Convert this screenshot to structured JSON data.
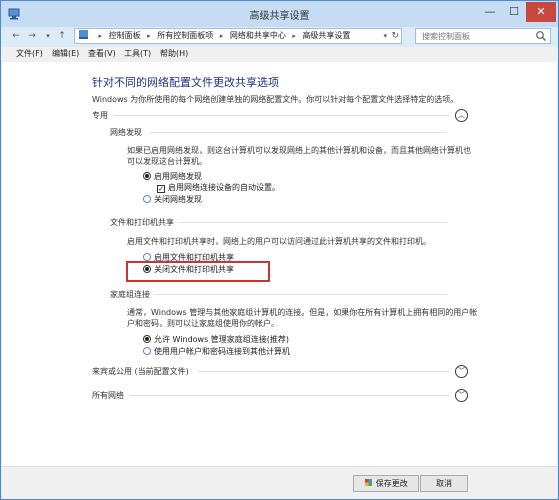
{
  "window": {
    "title": "高级共享设置",
    "min_glyph": "—",
    "max_glyph": "☐",
    "close_glyph": "✕"
  },
  "nav": {
    "back": "←",
    "forward": "→",
    "up": "↑",
    "breadcrumbs": [
      "控制面板",
      "所有控制面板项",
      "网络和共享中心",
      "高级共享设置"
    ],
    "search_placeholder": "搜索控制面板"
  },
  "menu": [
    "文件(F)",
    "编辑(E)",
    "查看(V)",
    "工具(T)",
    "帮助(H)"
  ],
  "main": {
    "heading": "针对不同的网络配置文件更改共享选项",
    "subtext": "Windows 为你所使用的每个网络创建单独的网络配置文件。你可以针对每个配置文件选择特定的选项。",
    "profile_private": {
      "label": "专用",
      "expander": "︿",
      "network_discovery": {
        "title": "网络发现",
        "desc_line1": "如果已启用网络发现，则这台计算机可以发现网络上的其他计算机和设备，而且其他网络计算机也",
        "desc_line2": "可以发现这台计算机。",
        "opt_on": "启用网络发现",
        "opt_auto": "启用网络连接设备的自动设置。",
        "opt_off": "关闭网络发现"
      },
      "file_printer": {
        "title": "文件和打印机共享",
        "desc": "启用文件和打印机共享时，网络上的用户可以访问通过此计算机共享的文件和打印机。",
        "opt_on": "启用文件和打印机共享",
        "opt_off": "关闭文件和打印机共享"
      },
      "homegroup": {
        "title": "家庭组连接",
        "desc_line1": "通常，Windows 管理与其他家庭组计算机的连接。但是，如果你在所有计算机上拥有相同的用户帐",
        "desc_line2": "户和密码，则可以让家庭组使用你的帐户。",
        "opt_windows": "允许 Windows 管理家庭组连接(推荐)",
        "opt_user": "使用用户帐户和密码连接到其他计算机"
      }
    },
    "profile_guest": {
      "label": "来宾或公用 (当前配置文件)",
      "expander": "﹀"
    },
    "profile_all": {
      "label": "所有网络",
      "expander": "﹀"
    }
  },
  "footer": {
    "save": "保存更改",
    "cancel": "取消"
  },
  "colors": {
    "accent": "#1e3287",
    "highlight": "#cc3333"
  }
}
